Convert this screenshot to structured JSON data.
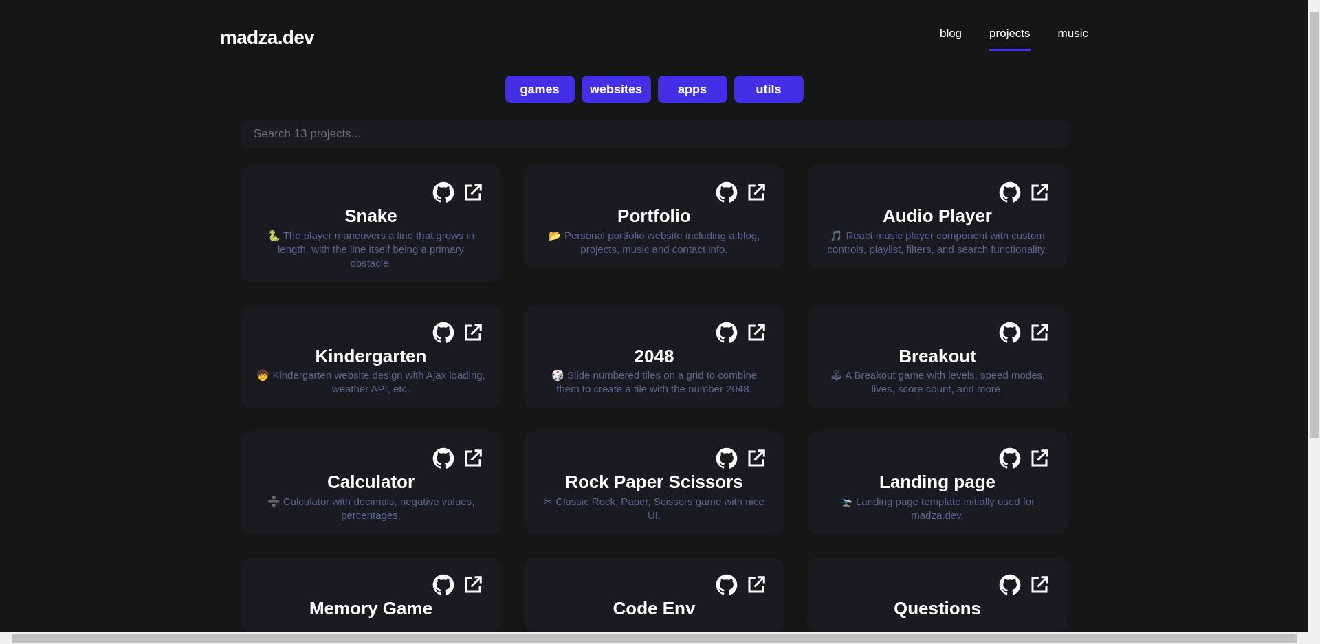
{
  "logo": "madza.dev",
  "nav": [
    {
      "label": "blog",
      "selected": false
    },
    {
      "label": "projects",
      "selected": true
    },
    {
      "label": "music",
      "selected": false
    }
  ],
  "filters": [
    "games",
    "websites",
    "apps",
    "utils"
  ],
  "search": {
    "placeholder": "Search 13 projects..."
  },
  "projects": [
    {
      "title": "Snake",
      "description": "🐍 The player maneuvers a line that grows in length, with the line itself being a primary obstacle."
    },
    {
      "title": "Portfolio",
      "description": "📂 Personal portfolio website including a blog, projects, music and contact info."
    },
    {
      "title": "Audio Player",
      "description": "🎵 React music player component with custom controls, playlist, filters, and search functionality."
    },
    {
      "title": "Kindergarten",
      "description": "🧒 Kindergarten website design with Ajax loading, weather API, etc."
    },
    {
      "title": "2048",
      "description": "🎲 Slide numbered tiles on a grid to combine them to create a tile with the number 2048."
    },
    {
      "title": "Breakout",
      "description": "🕹 A Breakout game with levels, speed modes, lives, score count, and more."
    },
    {
      "title": "Calculator",
      "description": "➗ Calculator with decimals, negative values, percentages."
    },
    {
      "title": "Rock Paper Scissors",
      "description": "✂ Classic Rock, Paper, Scissors game with nice UI."
    },
    {
      "title": "Landing page",
      "description": "🛬 Landing page template initially used for madza.dev."
    },
    {
      "title": "Memory Game"
    },
    {
      "title": "Code Env"
    },
    {
      "title": "Questions"
    }
  ]
}
